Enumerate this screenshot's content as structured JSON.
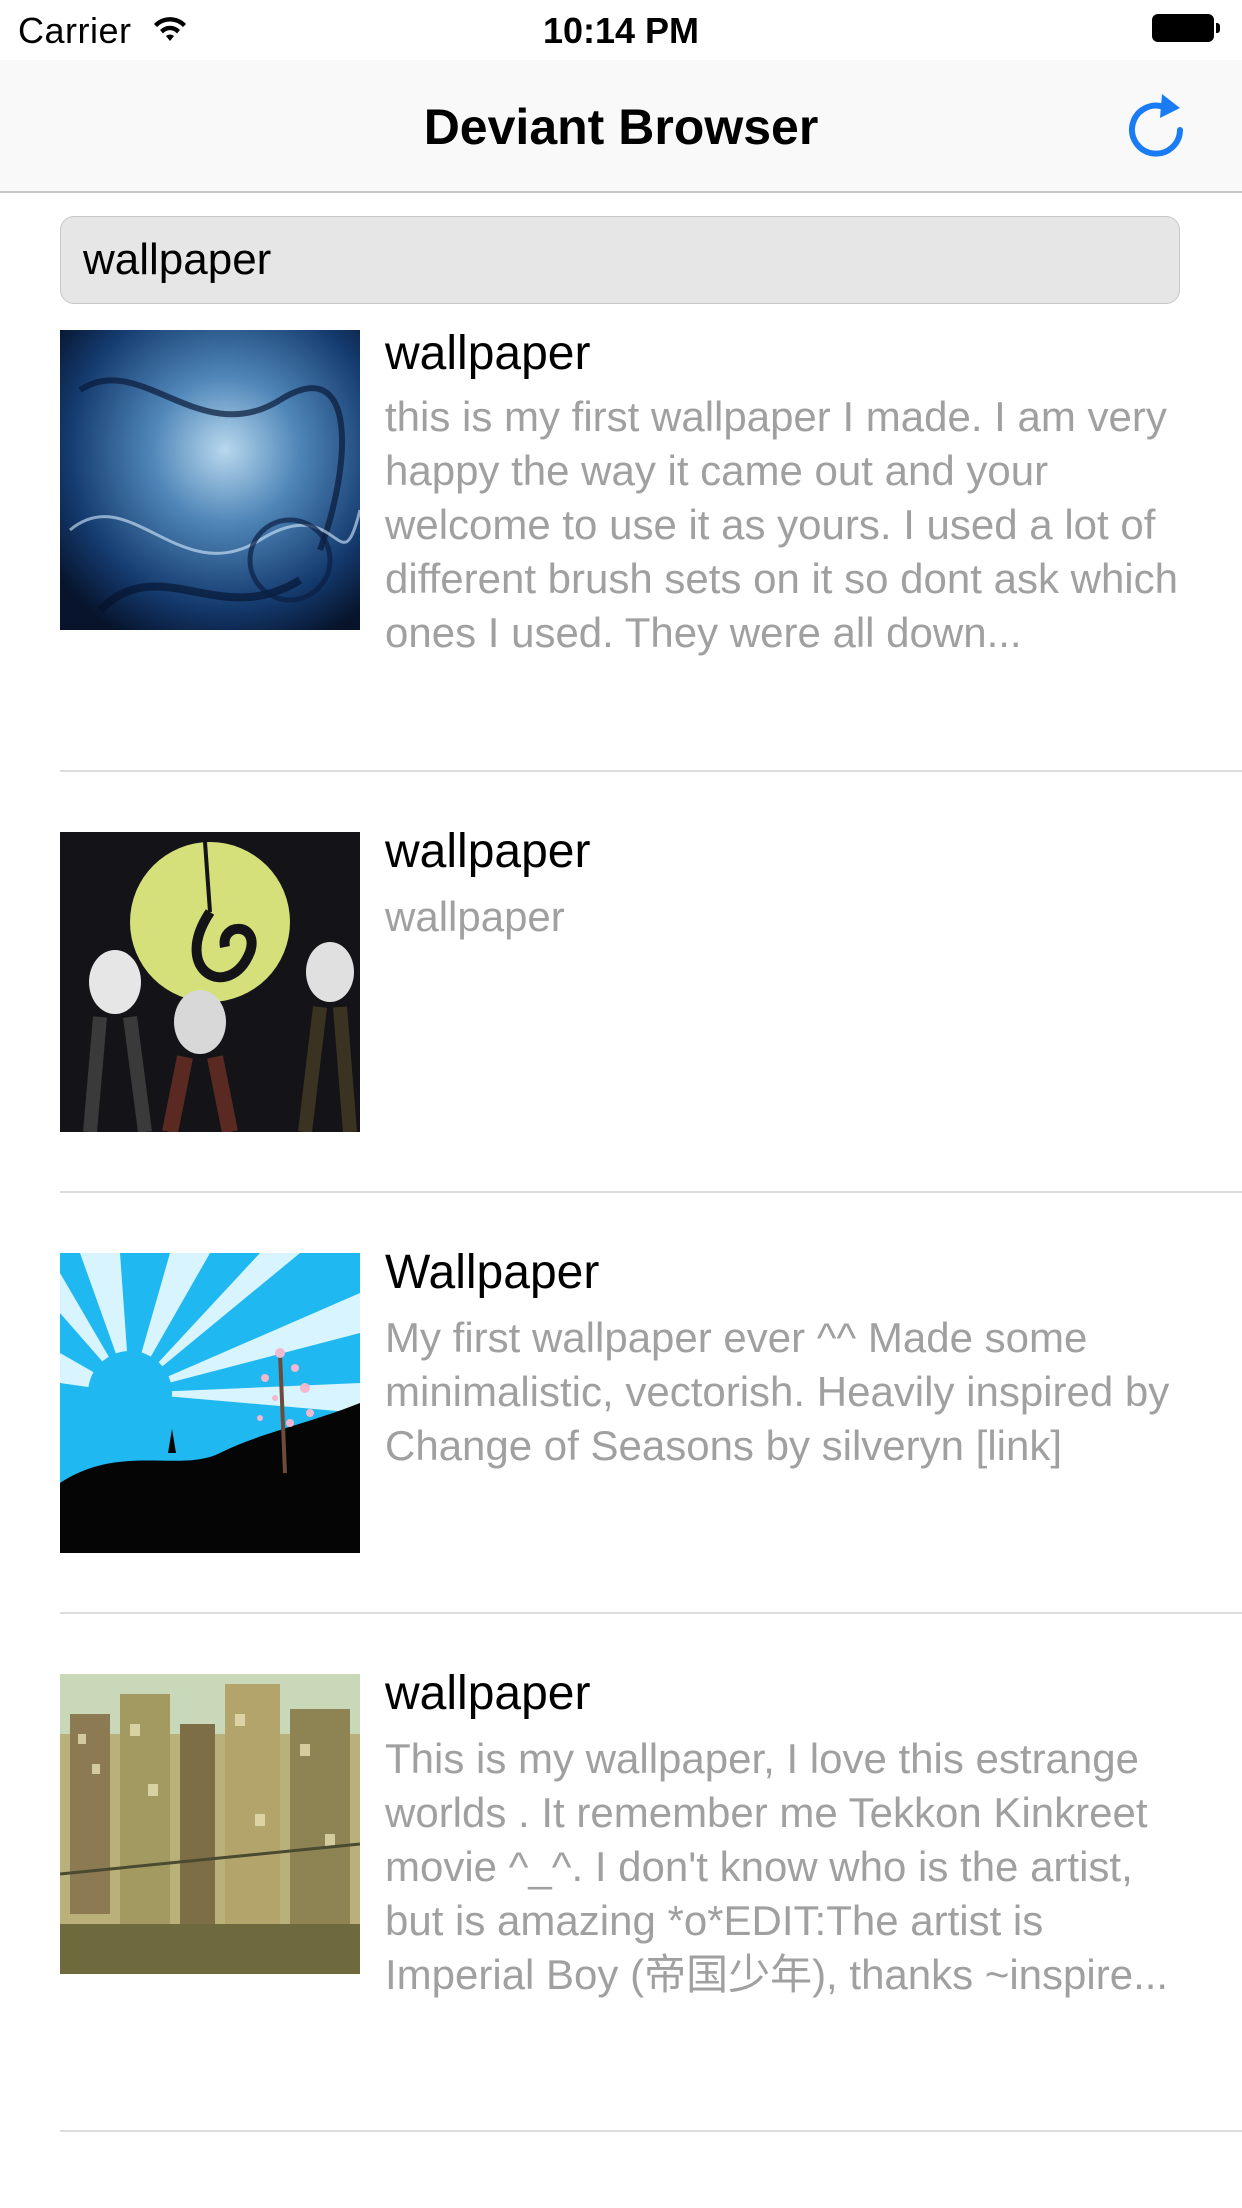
{
  "status_bar": {
    "carrier": "Carrier",
    "time": "10:14 PM"
  },
  "nav": {
    "title": "Deviant Browser",
    "refresh_icon": "refresh-icon"
  },
  "search": {
    "value": "wallpaper",
    "placeholder": ""
  },
  "results": [
    {
      "title": "wallpaper",
      "description": "this is my first wallpaper I made. I am very happy the way it came out and your welcome to use it as yours. I used a lot of different brush sets on it so dont ask which ones I used. They were all down...",
      "thumbnail": "blue-abstract-thumbnail"
    },
    {
      "title": "wallpaper",
      "description": "wallpaper",
      "thumbnail": "nightmare-before-christmas-thumbnail"
    },
    {
      "title": "Wallpaper",
      "description": "My first wallpaper ever ^^ Made some minimalistic, vectorish. Heavily inspired by Change of Seasons by silveryn [link]",
      "thumbnail": "sunburst-landscape-thumbnail"
    },
    {
      "title": "wallpaper",
      "description": "This is my wallpaper, I love this estrange worlds . It remember me Tekkon Kinkreet movie ^_^. I don't know who is the artist, but is amazing *o*EDIT:The artist is Imperial Boy (帝国少年), thanks ~inspire...",
      "thumbnail": "city-illustration-thumbnail"
    }
  ],
  "colors": {
    "accent": "#1a7cf5",
    "description_text": "#a0a0a0",
    "search_bg": "#e6e6e6"
  }
}
